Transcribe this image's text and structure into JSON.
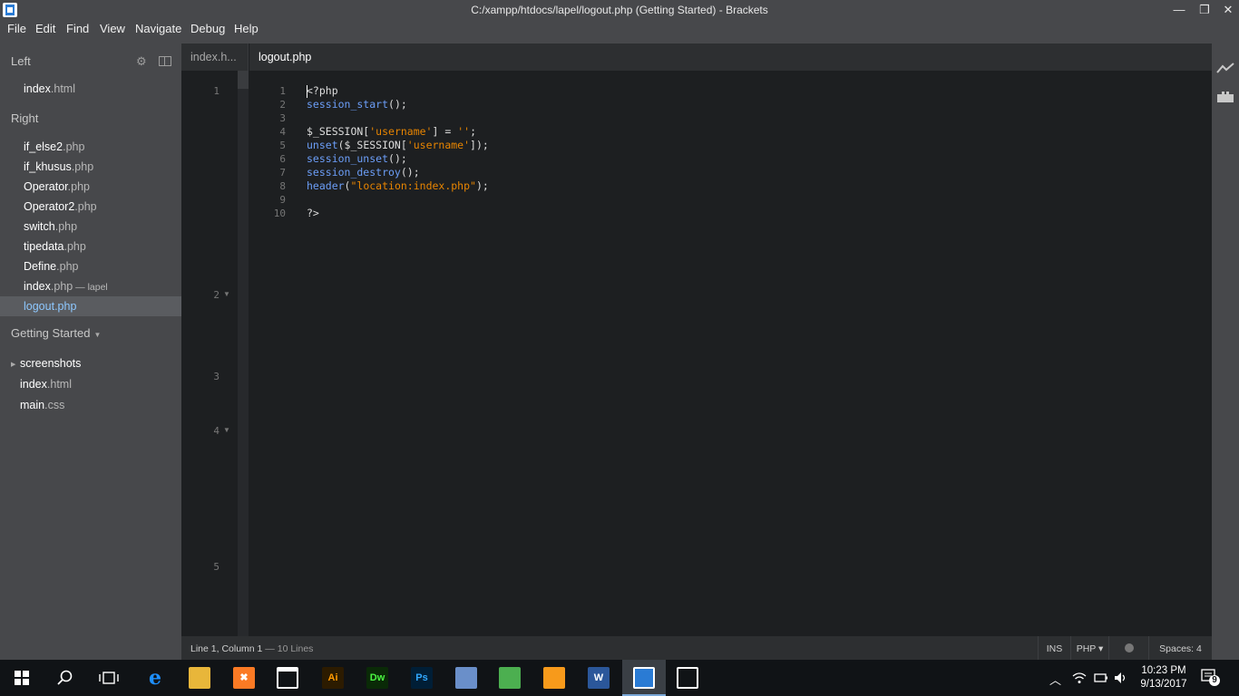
{
  "window": {
    "title": "C:/xampp/htdocs/lapel/logout.php (Getting Started) - Brackets",
    "min_glyph": "—",
    "max_glyph": "❐",
    "close_glyph": "✕"
  },
  "menu": [
    "File",
    "Edit",
    "Find",
    "View",
    "Navigate",
    "Debug",
    "Help"
  ],
  "sidebar": {
    "left_heading": "Left",
    "left_files": [
      {
        "name": "index",
        "ext": ".html"
      }
    ],
    "right_heading": "Right",
    "right_files": [
      {
        "name": "if_else2",
        "ext": ".php"
      },
      {
        "name": "if_khusus",
        "ext": ".php"
      },
      {
        "name": "Operator",
        "ext": ".php"
      },
      {
        "name": "Operator2",
        "ext": ".php"
      },
      {
        "name": "switch",
        "ext": ".php"
      },
      {
        "name": "tipedata",
        "ext": ".php"
      },
      {
        "name": "Define",
        "ext": ".php"
      },
      {
        "name": "index",
        "ext": ".php",
        "dir": " — lapel"
      },
      {
        "name": "logout",
        "ext": ".php"
      }
    ],
    "project_heading": "Getting Started",
    "project_caret": "▼",
    "tree": [
      {
        "name": "screenshots",
        "ext": ""
      },
      {
        "name": "index",
        "ext": ".html"
      },
      {
        "name": "main",
        "ext": ".css"
      }
    ],
    "tree_caret": "▶"
  },
  "left_pane": {
    "tab_label": "index.h...",
    "lines": [
      "1",
      "2",
      "3",
      "4",
      "5"
    ],
    "fold_glyph": "▼"
  },
  "main_pane": {
    "tab_label": "logout.php",
    "line_numbers": [
      "1",
      "2",
      "3",
      "4",
      "5",
      "6",
      "7",
      "8",
      "9",
      "10"
    ]
  },
  "code_lines": [
    [
      {
        "t": "<?php",
        "c": ""
      }
    ],
    [
      {
        "t": "session_start",
        "c": "kw"
      },
      {
        "t": "();",
        "c": ""
      }
    ],
    [],
    [
      {
        "t": "$_SESSION[",
        "c": ""
      },
      {
        "t": "'username'",
        "c": "str"
      },
      {
        "t": "] = ",
        "c": ""
      },
      {
        "t": "''",
        "c": "str"
      },
      {
        "t": ";",
        "c": ""
      }
    ],
    [
      {
        "t": "unset",
        "c": "kw"
      },
      {
        "t": "($_SESSION[",
        "c": ""
      },
      {
        "t": "'username'",
        "c": "str"
      },
      {
        "t": "]);",
        "c": ""
      }
    ],
    [
      {
        "t": "session_unset",
        "c": "kw"
      },
      {
        "t": "();",
        "c": ""
      }
    ],
    [
      {
        "t": "session_destroy",
        "c": "kw"
      },
      {
        "t": "();",
        "c": ""
      }
    ],
    [
      {
        "t": "header",
        "c": "kw"
      },
      {
        "t": "(",
        "c": ""
      },
      {
        "t": "\"location:index.php\"",
        "c": "str"
      },
      {
        "t": ");",
        "c": ""
      }
    ],
    [],
    [
      {
        "t": "?>",
        "c": ""
      }
    ]
  ],
  "status": {
    "position": "Line 1, Column 1",
    "lines": " — 10 Lines",
    "mode": "INS",
    "language": "PHP ▾",
    "spaces": "Spaces: 4"
  },
  "taskbar": {
    "time": "10:23 PM",
    "date": "9/13/2017",
    "notification_count": "9",
    "apps": [
      {
        "name": "ie-edge",
        "label": "e",
        "color": "#1e90ff",
        "bg": "transparent"
      },
      {
        "name": "file-explorer",
        "label": "",
        "color": "#f5c542",
        "bg": "#e8b63a"
      },
      {
        "name": "xampp",
        "label": "✖",
        "color": "#fff",
        "bg": "#fb7a24"
      },
      {
        "name": "store",
        "label": "",
        "color": "#fff",
        "bg": "transparent"
      },
      {
        "name": "illustrator",
        "label": "Ai",
        "color": "#ff9a00",
        "bg": "#2c1b00"
      },
      {
        "name": "dreamweaver",
        "label": "Dw",
        "color": "#4bf542",
        "bg": "#0a2a07"
      },
      {
        "name": "photoshop",
        "label": "Ps",
        "color": "#31a8ff",
        "bg": "#001e36"
      },
      {
        "name": "virtualbox",
        "label": "",
        "color": "#fff",
        "bg": "#6a8fc9"
      },
      {
        "name": "sublime",
        "label": "",
        "color": "#fff",
        "bg": "#4caf50"
      },
      {
        "name": "uc-browser",
        "label": "",
        "color": "#fff",
        "bg": "#f79a1b"
      },
      {
        "name": "word",
        "label": "W",
        "color": "#fff",
        "bg": "#2b579a"
      },
      {
        "name": "brackets",
        "label": "",
        "color": "#fff",
        "bg": "#2a7bd4"
      },
      {
        "name": "photos",
        "label": "",
        "color": "#fff",
        "bg": "transparent"
      }
    ]
  }
}
